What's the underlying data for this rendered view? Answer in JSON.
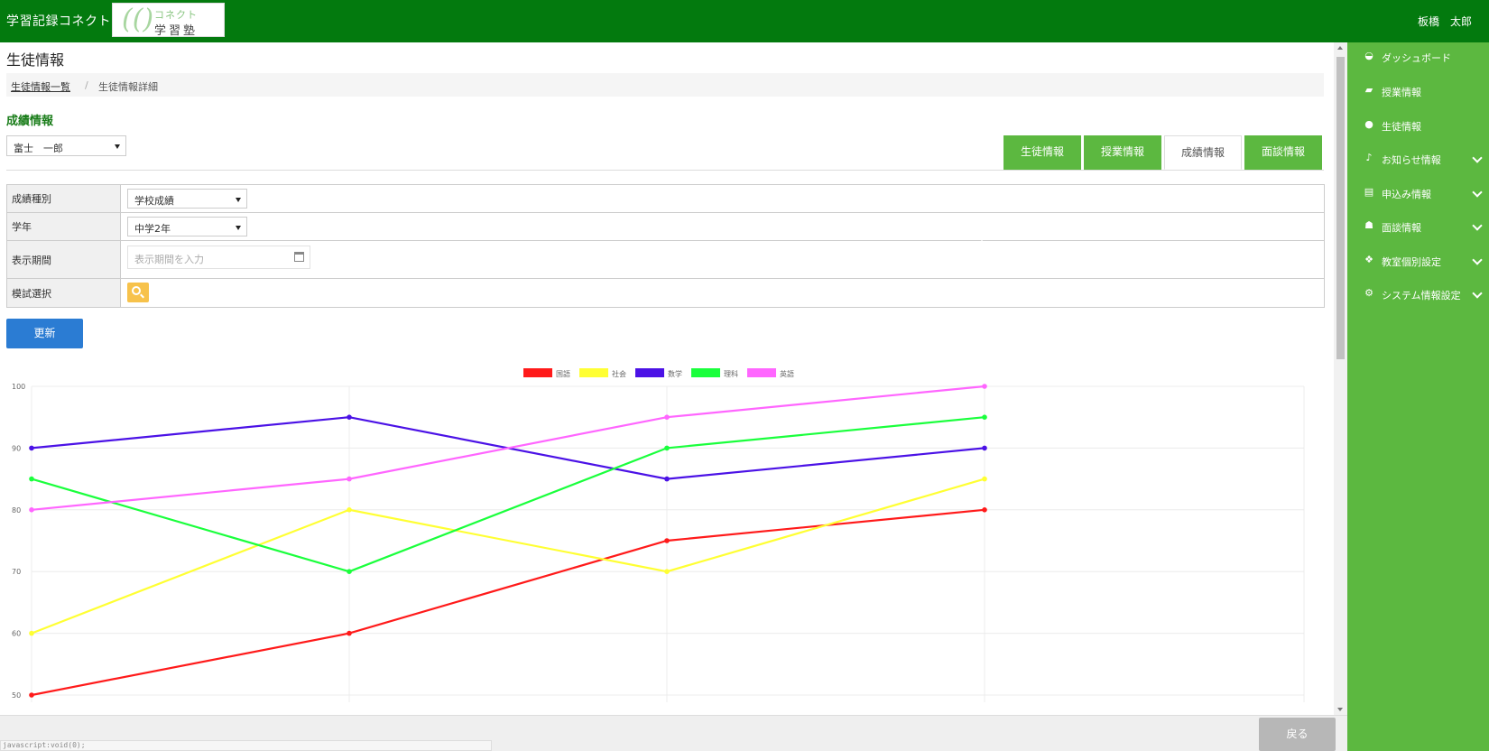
{
  "header": {
    "app_title": "学習記録コネクト",
    "logo_top": "コネクト",
    "logo_bottom": "学習塾",
    "user_name": "板橋　太郎"
  },
  "sidebar": {
    "items": [
      {
        "label": "ダッシュボード",
        "icon": "dashboard-icon",
        "expandable": false
      },
      {
        "label": "授業情報",
        "icon": "book-icon",
        "expandable": false
      },
      {
        "label": "生徒情報",
        "icon": "user-icon",
        "expandable": false
      },
      {
        "label": "お知らせ情報",
        "icon": "bell-icon",
        "expandable": true
      },
      {
        "label": "申込み情報",
        "icon": "card-icon",
        "expandable": true
      },
      {
        "label": "面談情報",
        "icon": "users-icon",
        "expandable": true
      },
      {
        "label": "教室個別設定",
        "icon": "cubes-icon",
        "expandable": true
      },
      {
        "label": "システム情報設定",
        "icon": "gear-icon",
        "expandable": true
      }
    ]
  },
  "page": {
    "title": "生徒情報",
    "breadcrumb": {
      "link": "生徒情報一覧",
      "separator": "/",
      "current": "生徒情報詳細"
    },
    "section_title": "成績情報",
    "student": "富士　一郎",
    "tabs": [
      {
        "label": "生徒情報",
        "active": false
      },
      {
        "label": "授業情報",
        "active": false
      },
      {
        "label": "成績情報",
        "active": true
      },
      {
        "label": "面談情報",
        "active": false
      }
    ]
  },
  "form": {
    "grade_type_label": "成績種別",
    "grade_type_value": "学校成績",
    "school_year_label": "学年",
    "school_year_value": "中学2年",
    "period_label": "表示期間",
    "period_placeholder": "表示期間を入力",
    "mock_label": "模試選択",
    "update_label": "更新"
  },
  "footer": {
    "back_label": "戻る",
    "status_url": "javascript:void(0);"
  },
  "chart_data": {
    "type": "line",
    "x": [
      1,
      2,
      3,
      4
    ],
    "ylim": [
      50,
      100
    ],
    "yticks": [
      50,
      60,
      70,
      80,
      90,
      100
    ],
    "grid": true,
    "legend": "top-center",
    "series": [
      {
        "name": "国語",
        "color": "#ff1a1a",
        "values": [
          50,
          60,
          75,
          80
        ]
      },
      {
        "name": "社会",
        "color": "#ffff33",
        "values": [
          60,
          80,
          70,
          85
        ]
      },
      {
        "name": "数学",
        "color": "#4b12e6",
        "values": [
          90,
          95,
          85,
          90
        ]
      },
      {
        "name": "理科",
        "color": "#1aff3c",
        "values": [
          85,
          70,
          90,
          95
        ]
      },
      {
        "name": "英語",
        "color": "#ff66ff",
        "values": [
          80,
          85,
          95,
          100
        ]
      }
    ]
  }
}
